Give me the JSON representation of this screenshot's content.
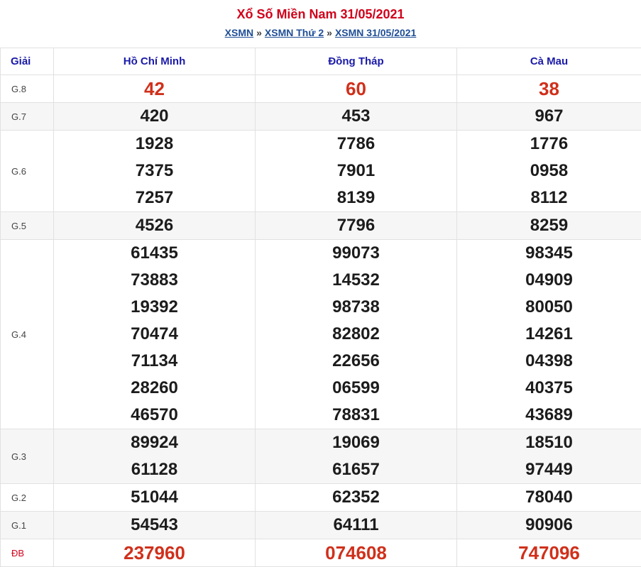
{
  "header": {
    "title": "Xổ Số Miền Nam 31/05/2021",
    "breadcrumb": [
      {
        "label": "XSMN"
      },
      {
        "label": "XSMN Thứ 2"
      },
      {
        "label": "XSMN 31/05/2021"
      }
    ],
    "separator": "»"
  },
  "table": {
    "giai_header": "Giải",
    "provinces": [
      "Hồ Chí Minh",
      "Đồng Tháp",
      "Cà Mau"
    ],
    "rows": [
      {
        "label": "G.8",
        "highlight": true,
        "values": [
          [
            "42"
          ],
          [
            "60"
          ],
          [
            "38"
          ]
        ]
      },
      {
        "label": "G.7",
        "values": [
          [
            "420"
          ],
          [
            "453"
          ],
          [
            "967"
          ]
        ]
      },
      {
        "label": "G.6",
        "values": [
          [
            "1928",
            "7375",
            "7257"
          ],
          [
            "7786",
            "7901",
            "8139"
          ],
          [
            "1776",
            "0958",
            "8112"
          ]
        ]
      },
      {
        "label": "G.5",
        "values": [
          [
            "4526"
          ],
          [
            "7796"
          ],
          [
            "8259"
          ]
        ]
      },
      {
        "label": "G.4",
        "values": [
          [
            "61435",
            "73883",
            "19392",
            "70474",
            "71134",
            "28260",
            "46570"
          ],
          [
            "99073",
            "14532",
            "98738",
            "82802",
            "22656",
            "06599",
            "78831"
          ],
          [
            "98345",
            "04909",
            "80050",
            "14261",
            "04398",
            "40375",
            "43689"
          ]
        ]
      },
      {
        "label": "G.3",
        "values": [
          [
            "89924",
            "61128"
          ],
          [
            "19069",
            "61657"
          ],
          [
            "18510",
            "97449"
          ]
        ]
      },
      {
        "label": "G.2",
        "values": [
          [
            "51044"
          ],
          [
            "62352"
          ],
          [
            "78040"
          ]
        ]
      },
      {
        "label": "G.1",
        "values": [
          [
            "54543"
          ],
          [
            "64111"
          ],
          [
            "90906"
          ]
        ]
      },
      {
        "label": "ĐB",
        "highlight": true,
        "special": true,
        "values": [
          [
            "237960"
          ],
          [
            "074608"
          ],
          [
            "747096"
          ]
        ]
      }
    ]
  },
  "colors": {
    "title": "#d0021b",
    "link": "#1f4e96",
    "province": "#1a1aa8",
    "highlight_number": "#d0301b",
    "alt_row": "#f6f6f6"
  }
}
